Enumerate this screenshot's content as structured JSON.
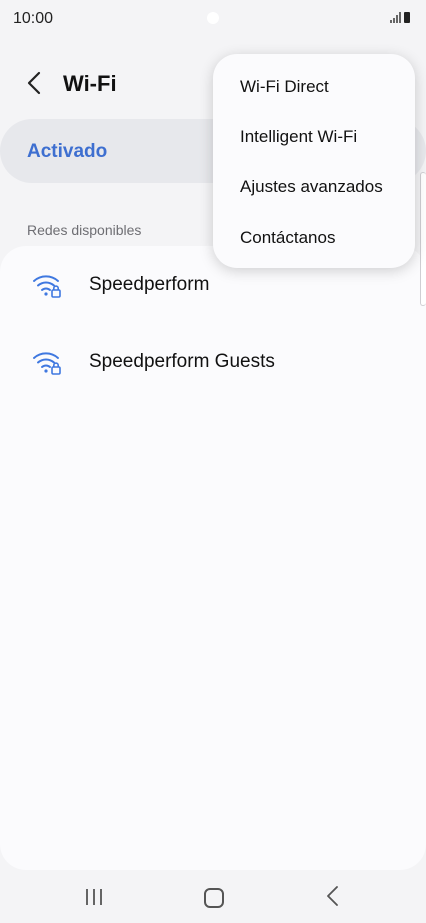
{
  "status_bar": {
    "time": "10:00"
  },
  "header": {
    "title": "Wi-Fi"
  },
  "wifi_toggle": {
    "label": "Activado",
    "accent_color": "#3e6fd0"
  },
  "networks": {
    "section_label": "Redes disponibles",
    "items": [
      {
        "name": "Speedperform",
        "icon": "wifi-lock-icon"
      },
      {
        "name": "Speedperform Guests",
        "icon": "wifi-lock-icon"
      }
    ]
  },
  "menu": {
    "items": [
      {
        "label": "Wi-Fi Direct"
      },
      {
        "label": "Intelligent Wi-Fi"
      },
      {
        "label": "Ajustes avanzados"
      },
      {
        "label": "Contáctanos"
      }
    ]
  }
}
